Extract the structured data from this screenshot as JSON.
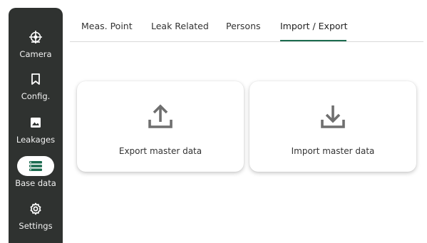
{
  "sidebar": {
    "items": [
      {
        "label": "Camera",
        "icon": "camera-target-icon",
        "active": false
      },
      {
        "label": "Config.",
        "icon": "bookmark-icon",
        "active": false
      },
      {
        "label": "Leakages",
        "icon": "image-icon",
        "active": false
      },
      {
        "label": "Base data",
        "icon": "list-icon",
        "active": true
      },
      {
        "label": "Settings",
        "icon": "gear-icon",
        "active": false
      }
    ]
  },
  "tabs": [
    {
      "label": "Meas. Point",
      "active": false
    },
    {
      "label": "Leak Related",
      "active": false
    },
    {
      "label": "Persons",
      "active": false
    },
    {
      "label": "Import / Export",
      "active": true
    }
  ],
  "cards": {
    "export": {
      "label": "Export master data",
      "icon": "upload-icon"
    },
    "import": {
      "label": "Import master data",
      "icon": "download-icon"
    }
  },
  "colors": {
    "sidebar_bg": "#2f3230",
    "accent_green": "#1b6b4f",
    "icon_grey": "#6f6f6f"
  }
}
